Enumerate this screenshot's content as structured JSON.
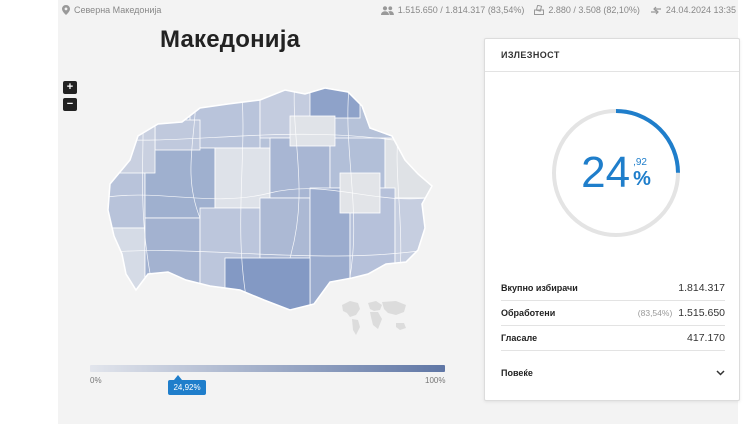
{
  "topbar": {
    "location": "Северна Македонија",
    "voters_processed": "1.515.650 / 1.814.317 (83,54%)",
    "stations_processed": "2.880 / 3.508 (82,10%)",
    "updated": "24.04.2024 13:35"
  },
  "map": {
    "title": "Македонија",
    "zoom_in_label": "+",
    "zoom_out_label": "−",
    "scale_min": "0%",
    "scale_max": "100%",
    "marker_label": "24,92%",
    "marker_value": 24.92
  },
  "turnout_card": {
    "header": "ИЗЛЕЗНОСТ",
    "gauge_int": "24",
    "gauge_dec": ",92",
    "gauge_pct": "%",
    "gauge_fraction": 0.2492,
    "rows": [
      {
        "label": "Вкупно избирачи",
        "sub": "",
        "value": "1.814.317"
      },
      {
        "label": "Обработени",
        "sub": "(83,54%)",
        "value": "1.515.650"
      },
      {
        "label": "Гласале",
        "sub": "",
        "value": "417.170"
      }
    ],
    "more_label": "Повеќе"
  },
  "colors": {
    "accent": "#1f7ecb",
    "map_light": "#dfe3ea",
    "map_dark": "#6d84b5"
  }
}
